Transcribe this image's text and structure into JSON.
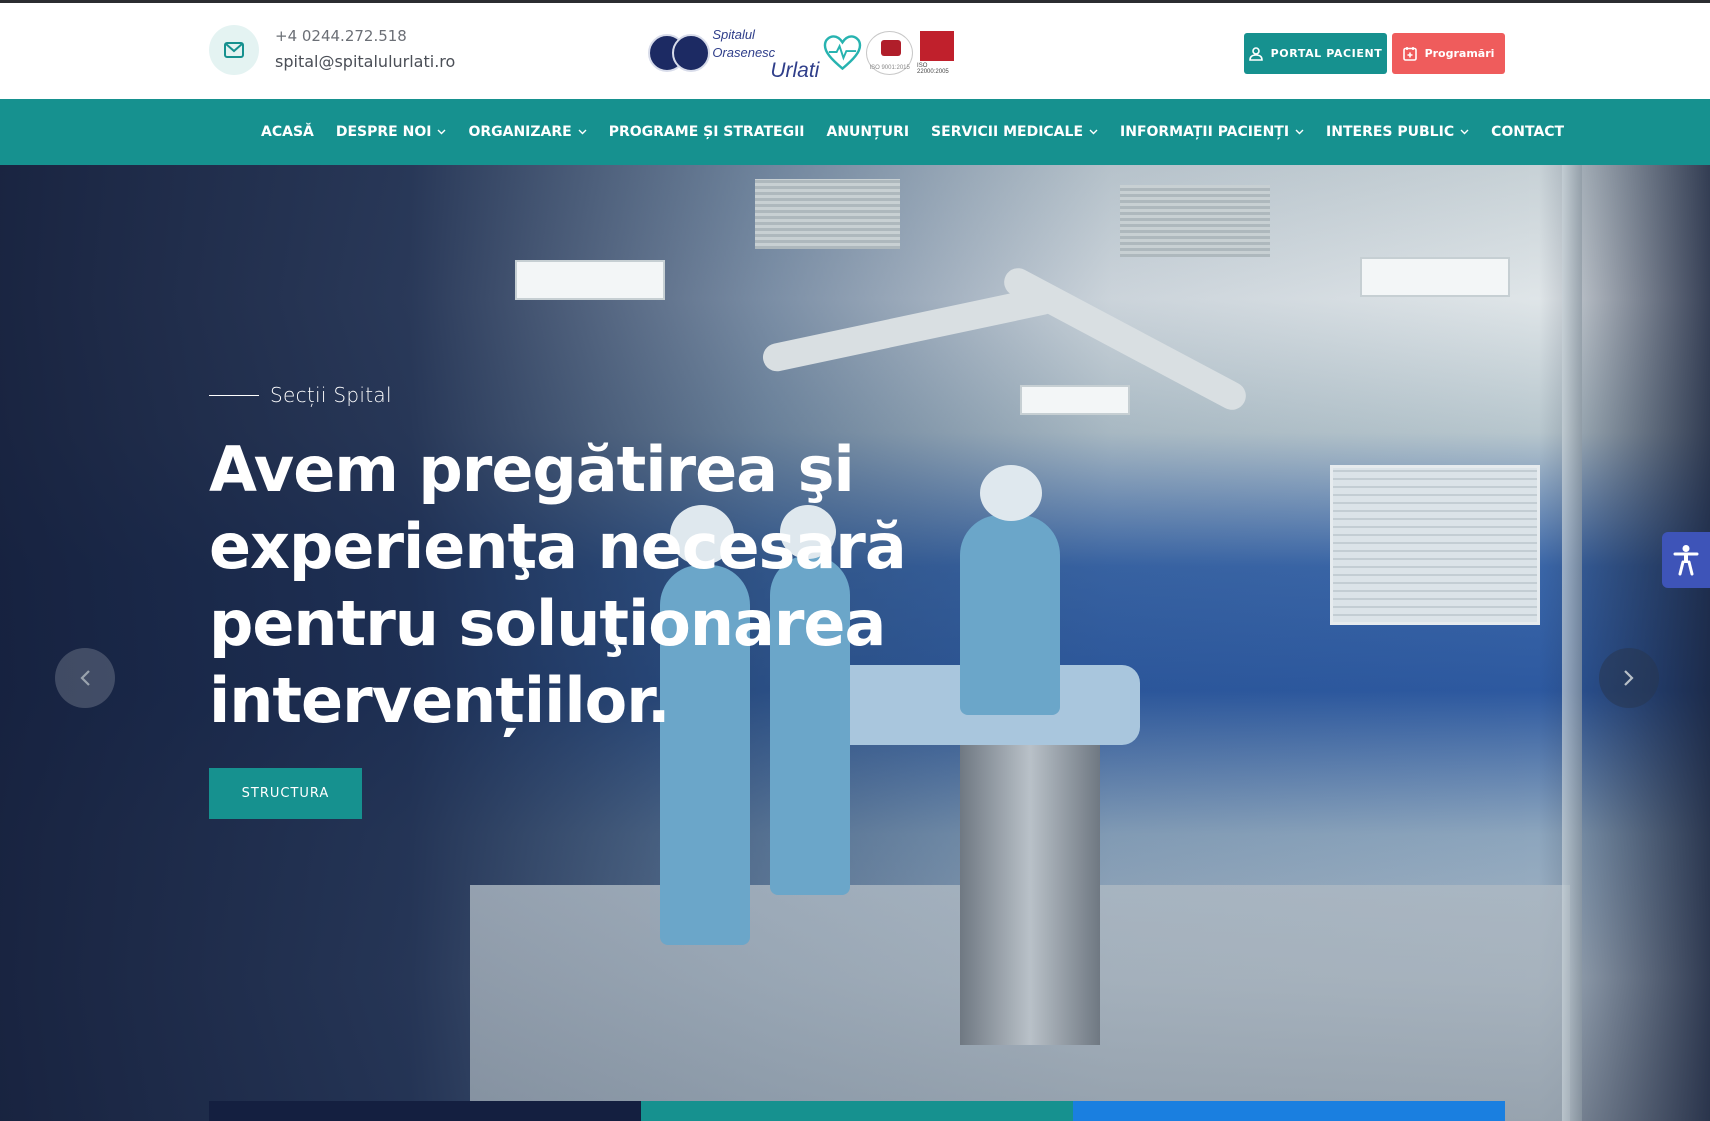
{
  "header": {
    "phone": "+4 0244.272.518",
    "email": "spital@spitalulurlati.ro",
    "logo": {
      "name_line1": "Spitalul Orasenesc",
      "name_line2": "Urlati",
      "iso1": "ISO 9001:2015",
      "iso2": "ISO 22000:2005"
    },
    "portal_button": "PORTAL PACIENT",
    "appointments_button": "Programări"
  },
  "nav": {
    "items": [
      {
        "label": "ACASĂ",
        "dropdown": false
      },
      {
        "label": "DESPRE NOI",
        "dropdown": true
      },
      {
        "label": "ORGANIZARE",
        "dropdown": true
      },
      {
        "label": "PROGRAME ȘI STRATEGII",
        "dropdown": false
      },
      {
        "label": "ANUNȚURI",
        "dropdown": false
      },
      {
        "label": "SERVICII MEDICALE",
        "dropdown": true
      },
      {
        "label": "INFORMAȚII PACIENȚI",
        "dropdown": true
      },
      {
        "label": "INTERES PUBLIC",
        "dropdown": true
      },
      {
        "label": "CONTACT",
        "dropdown": false
      }
    ]
  },
  "hero": {
    "tagline": "Secții Spital",
    "headline": "Avem pregătirea şi experienţa necesară pentru soluţionarea intervențiilor.",
    "button": "STRUCTURA"
  },
  "colors": {
    "primary": "#16918f",
    "accent": "#ef5c5c",
    "accessibility": "#3e54b8",
    "tab1": "#141f40",
    "tab2": "#16918f",
    "tab3": "#1a7fe0"
  },
  "icons": {
    "contact": "envelope-icon",
    "portal": "user-icon",
    "appointments": "calendar-plus-icon",
    "prev": "chevron-left-icon",
    "next": "chevron-right-icon",
    "accessibility": "accessibility-icon"
  }
}
